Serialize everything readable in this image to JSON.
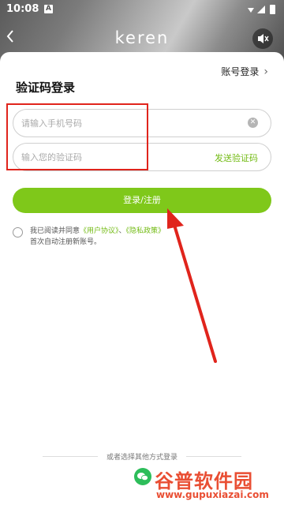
{
  "status_bar": {
    "time": "10:08",
    "notification_letter": "A"
  },
  "header": {
    "back_icon": "chevron-left-icon",
    "logo": "keren",
    "mute_icon": "speaker-mute-icon"
  },
  "login": {
    "account_login_label": "账号登录",
    "title": "验证码登录",
    "phone_placeholder": "请输入手机号码",
    "code_placeholder": "输入您的验证码",
    "send_code_label": "发送验证码",
    "submit_label": "登录/注册"
  },
  "agreement": {
    "prefix": "我已阅读并同意",
    "user_agreement": "《用户协议》",
    "separator": "、",
    "privacy_policy": "《隐私政策》",
    "suffix": "首次自动注册新账号。"
  },
  "other_login": {
    "label": "或者选择其他方式登录",
    "wechat_icon": "wechat-icon"
  },
  "watermark": {
    "main": "谷普软件园",
    "url": "www.gupuxiazai.com"
  },
  "colors": {
    "accent": "#7fc81a",
    "link": "#73bb14",
    "annotation_red": "#e0241c"
  }
}
